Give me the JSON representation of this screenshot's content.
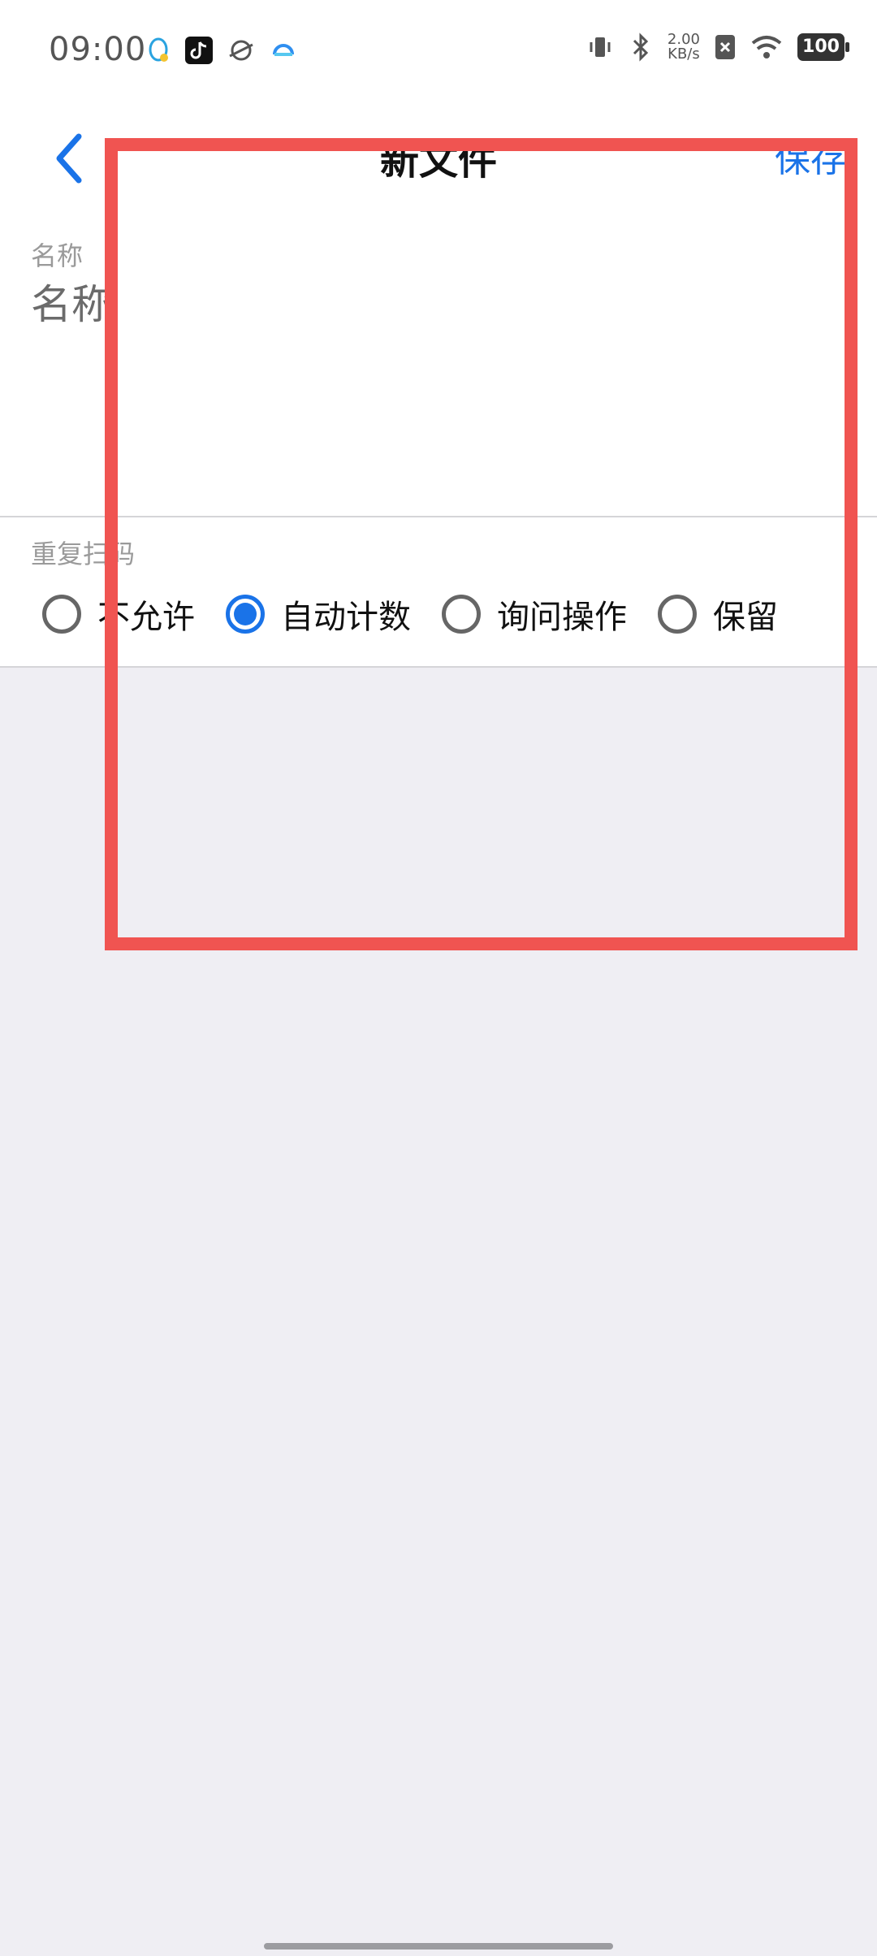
{
  "status_bar": {
    "time": "09:00",
    "net_speed_value": "2.00",
    "net_speed_unit": "KB/s",
    "battery": "100"
  },
  "header": {
    "title": "新文件",
    "save_label": "保存"
  },
  "name_field": {
    "label": "名称",
    "placeholder": "名称"
  },
  "duplicate": {
    "label": "重复扫码",
    "options": [
      {
        "label": "不允许",
        "checked": false
      },
      {
        "label": "自动计数",
        "checked": true
      },
      {
        "label": "询问操作",
        "checked": false
      },
      {
        "label": "保留",
        "checked": false
      }
    ]
  },
  "colors": {
    "accent": "#1a73e8",
    "highlight": "#f05451",
    "background": "#efeef3"
  }
}
